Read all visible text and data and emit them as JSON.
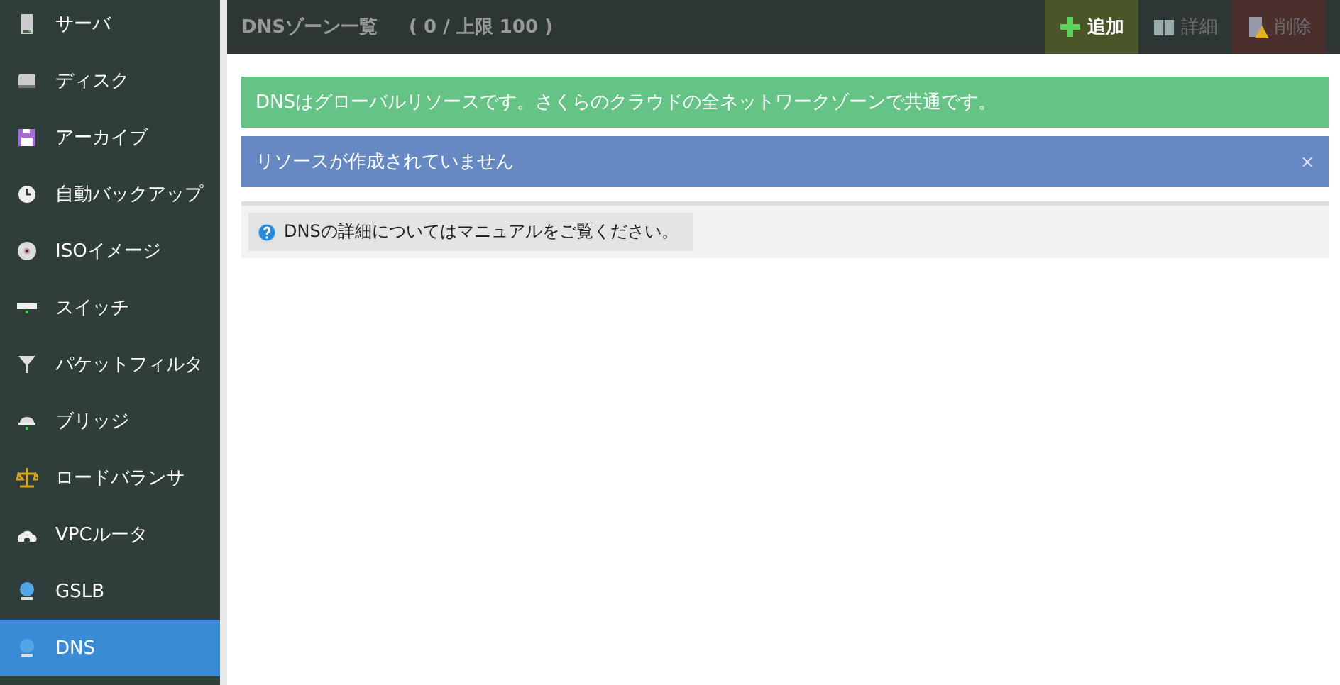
{
  "sidebar": {
    "items": [
      {
        "label": "サーバ",
        "kind": "server",
        "selected": false
      },
      {
        "label": "ディスク",
        "kind": "disk",
        "selected": false
      },
      {
        "label": "アーカイブ",
        "kind": "archive",
        "selected": false
      },
      {
        "label": "自動バックアップ",
        "kind": "clock",
        "selected": false
      },
      {
        "label": "ISOイメージ",
        "kind": "cd",
        "selected": false
      },
      {
        "label": "スイッチ",
        "kind": "switch",
        "selected": false
      },
      {
        "label": "パケットフィルタ",
        "kind": "filter",
        "selected": false
      },
      {
        "label": "ブリッジ",
        "kind": "bridge",
        "selected": false
      },
      {
        "label": "ロードバランサ",
        "kind": "scale",
        "selected": false
      },
      {
        "label": "VPCルータ",
        "kind": "router",
        "selected": false
      },
      {
        "label": "GSLB",
        "kind": "globe",
        "selected": false
      },
      {
        "label": "DNS",
        "kind": "globe",
        "selected": true
      }
    ]
  },
  "header": {
    "title": "DNSゾーン一覧",
    "count": "( 0 / 上限 100 )",
    "buttons": [
      {
        "label": "追加",
        "kind": "add",
        "disabled": false
      },
      {
        "label": "詳細",
        "kind": "detail",
        "disabled": true
      },
      {
        "label": "削除",
        "kind": "delete",
        "disabled": true
      }
    ]
  },
  "alerts": [
    {
      "text": "DNSはグローバルリソースです。さくらのクラウドの全ネットワークゾーンで共通です。",
      "kind": "success"
    },
    {
      "text": "リソースが作成されていません",
      "kind": "info",
      "close": "×"
    }
  ],
  "help": {
    "text": "DNSの詳細についてはマニュアルをご覧ください。"
  }
}
